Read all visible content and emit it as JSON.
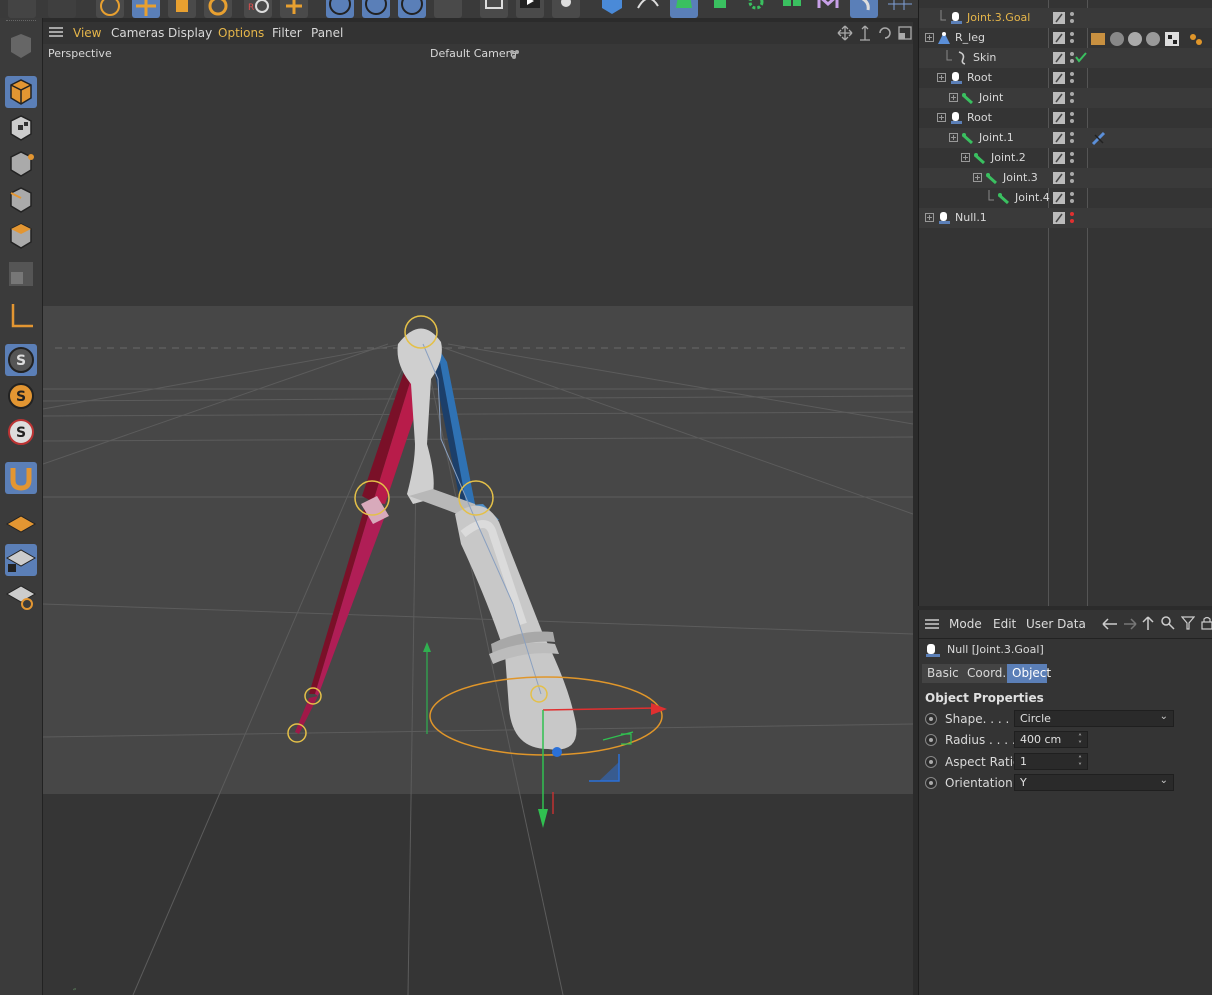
{
  "viewport": {
    "menu": [
      "View",
      "Cameras",
      "Display",
      "Options",
      "Filter",
      "Panel"
    ],
    "projection_label": "Perspective",
    "camera_label": "Default Camera"
  },
  "object_manager": {
    "items": [
      {
        "name": "Joint.3.Goal",
        "icon": "null-icon",
        "selected": true
      },
      {
        "name": "R_leg",
        "icon": "character-icon"
      },
      {
        "name": "Skin",
        "icon": "skin-icon"
      },
      {
        "name": "Root",
        "icon": "null-icon"
      },
      {
        "name": "Joint",
        "icon": "joint-icon"
      },
      {
        "name": "Root",
        "icon": "null-icon"
      },
      {
        "name": "Joint.1",
        "icon": "joint-icon"
      },
      {
        "name": "Joint.2",
        "icon": "joint-icon"
      },
      {
        "name": "Joint.3",
        "icon": "joint-icon"
      },
      {
        "name": "Joint.4",
        "icon": "joint-icon"
      },
      {
        "name": "Null.1",
        "icon": "null-icon"
      }
    ]
  },
  "attribute_manager": {
    "menu": [
      "Mode",
      "Edit",
      "User Data"
    ],
    "object_title": "Null [Joint.3.Goal]",
    "tabs": [
      "Basic",
      "Coord.",
      "Object"
    ],
    "active_tab": "Object",
    "section_title": "Object Properties",
    "properties": [
      {
        "label": "Shape. . . . .",
        "value": "Circle"
      },
      {
        "label": "Radius . . . .",
        "value": "400 cm"
      },
      {
        "label": "Aspect Ratio",
        "value": "1"
      },
      {
        "label": "Orientation",
        "value": "Y"
      }
    ]
  },
  "colors": {
    "accent": "#5b7fb7",
    "highlight_text": "#e6b64a",
    "bone_red": "#a01840",
    "bone_blue": "#2a6aa8",
    "axis_x": "#e03030",
    "axis_y": "#30c050",
    "goal_circle": "#e0962a"
  }
}
